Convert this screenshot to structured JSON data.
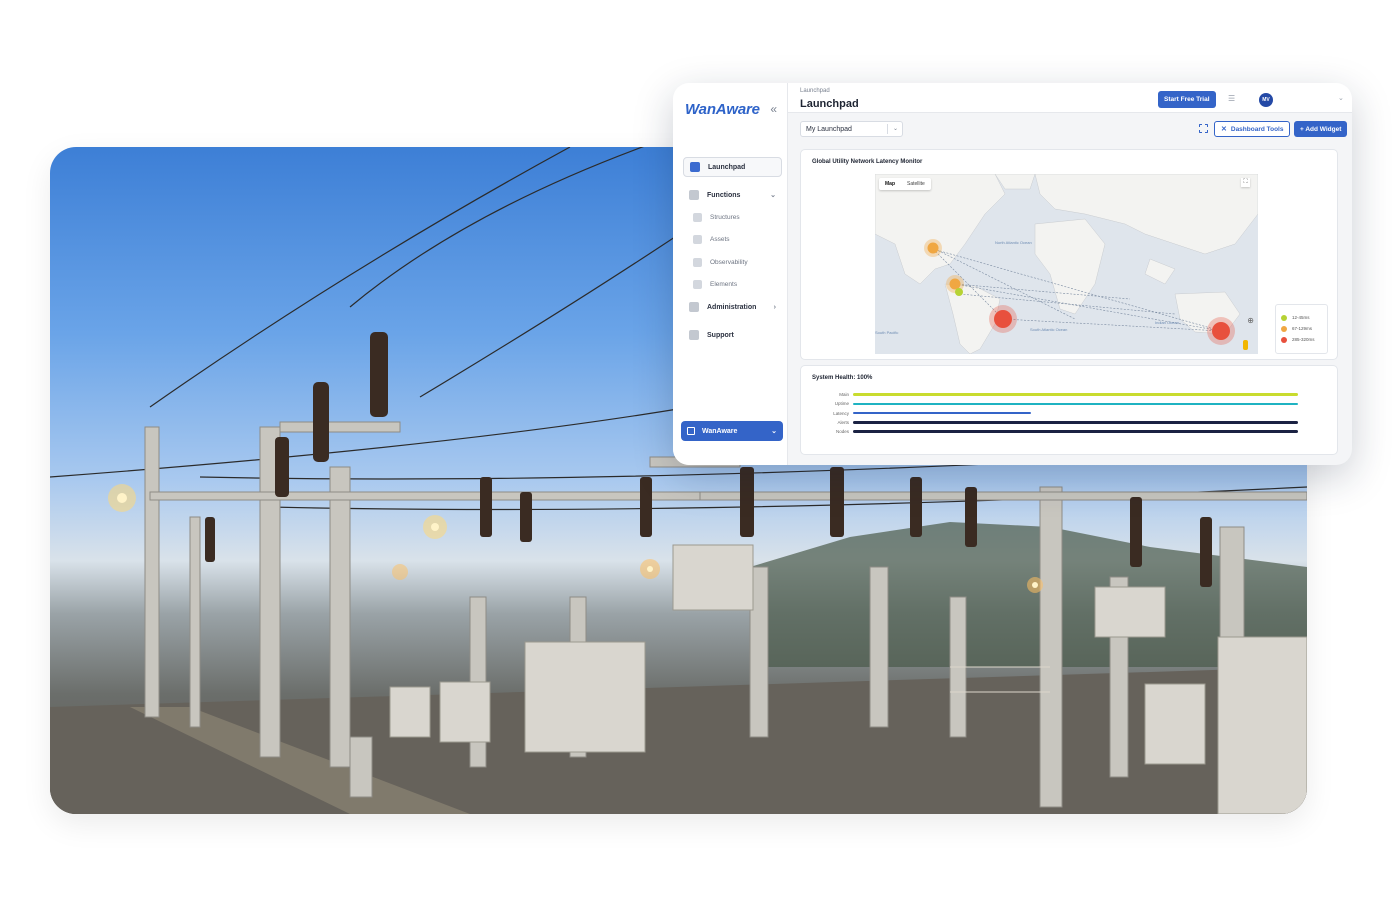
{
  "app": {
    "brand": "WanAware",
    "collapse_icon": "double-chevron-left-icon",
    "breadcrumb": "Launchpad",
    "page_title": "Launchpad",
    "start_trial_label": "Start Free Trial",
    "avatar_initials": "MV"
  },
  "sidebar": {
    "items": [
      {
        "label": "Launchpad",
        "icon": "home-icon",
        "active": true
      },
      {
        "label": "Functions",
        "icon": "functions-icon",
        "expanded": true
      },
      {
        "label": "Structures",
        "icon": "structures-icon",
        "sub": true
      },
      {
        "label": "Assets",
        "icon": "assets-icon",
        "sub": true
      },
      {
        "label": "Observability",
        "icon": "observability-icon",
        "sub": true
      },
      {
        "label": "Elements",
        "icon": "elements-icon",
        "sub": true
      },
      {
        "label": "Administration",
        "icon": "wrench-icon"
      },
      {
        "label": "Support",
        "icon": "mail-icon"
      }
    ],
    "workspace_label": "WanAware"
  },
  "toolbar": {
    "launchpad_select": "My Launchpad",
    "dashboard_tools_label": "Dashboard Tools",
    "add_widget_label": "+ Add Widget"
  },
  "map_widget": {
    "title": "Global Utility Network Latency Monitor",
    "tabs": [
      "Map",
      "Satellite"
    ],
    "active_tab": "Map",
    "ocean_labels": [
      "North Atlantic Ocean",
      "South Atlantic Ocean",
      "South Pacific",
      "Indian Ocean"
    ],
    "legend": [
      {
        "label": "12-45ms",
        "color": "#b6d234"
      },
      {
        "label": "67-129ms",
        "color": "#f0a742"
      },
      {
        "label": "285-320ms",
        "color": "#e8503d"
      }
    ]
  },
  "health_widget": {
    "title": "System Health: 100%",
    "rows": [
      {
        "label": "Main",
        "value": 1.0,
        "color": "#c9dc2e"
      },
      {
        "label": "Uptime",
        "value": 1.0,
        "color": "#1fb3c2"
      },
      {
        "label": "Latency",
        "value": 0.4,
        "color": "#3464c8"
      },
      {
        "label": "Alerts",
        "value": 1.0,
        "color": "#1b2243"
      },
      {
        "label": "Nodes",
        "value": 1.0,
        "color": "#1b2243"
      }
    ]
  }
}
